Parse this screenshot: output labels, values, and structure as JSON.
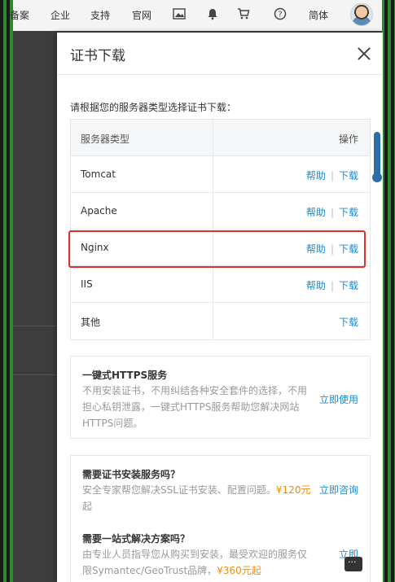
{
  "topnav": {
    "items": [
      "备案",
      "企业",
      "支持",
      "官网",
      "简体"
    ]
  },
  "modal": {
    "title": "证书下载",
    "instruction": "请根据您的服务器类型选择证书下载：",
    "table": {
      "header": {
        "server_type": "服务器类型",
        "operation": "操作"
      },
      "rows": [
        {
          "name": "Tomcat",
          "help": "帮助",
          "download": "下载"
        },
        {
          "name": "Apache",
          "help": "帮助",
          "download": "下载"
        },
        {
          "name": "Nginx",
          "help": "帮助",
          "download": "下载"
        },
        {
          "name": "IIS",
          "help": "帮助",
          "download": "下载"
        },
        {
          "name": "其他",
          "download": "下载"
        }
      ],
      "separator": "|"
    },
    "https_card": {
      "title": "一键式HTTPS服务",
      "text": "不用安装证书，不用纠结各种安全套件的选择，不用担心私钥泄露，一键式HTTPS服务帮助您解决网站HTTPS问题。",
      "action": "立即使用"
    },
    "install_card": {
      "title": "需要证书安装服务吗？",
      "text": "安全专家帮您解决SSL证书安装、配置问题。",
      "price": "¥120元",
      "text_tail": "起",
      "action": "立即咨询"
    },
    "solution_card": {
      "title": "需要一站式解决方案吗？",
      "text": "由专业人员指导您从购买到安装，最受欢迎的服务仅限Symantec/GeoTrust品牌，",
      "price": "¥360元起",
      "action": "立即"
    }
  },
  "colors": {
    "link": "#1a8bd8",
    "highlight": "#e0302a",
    "price": "#f08c00"
  }
}
